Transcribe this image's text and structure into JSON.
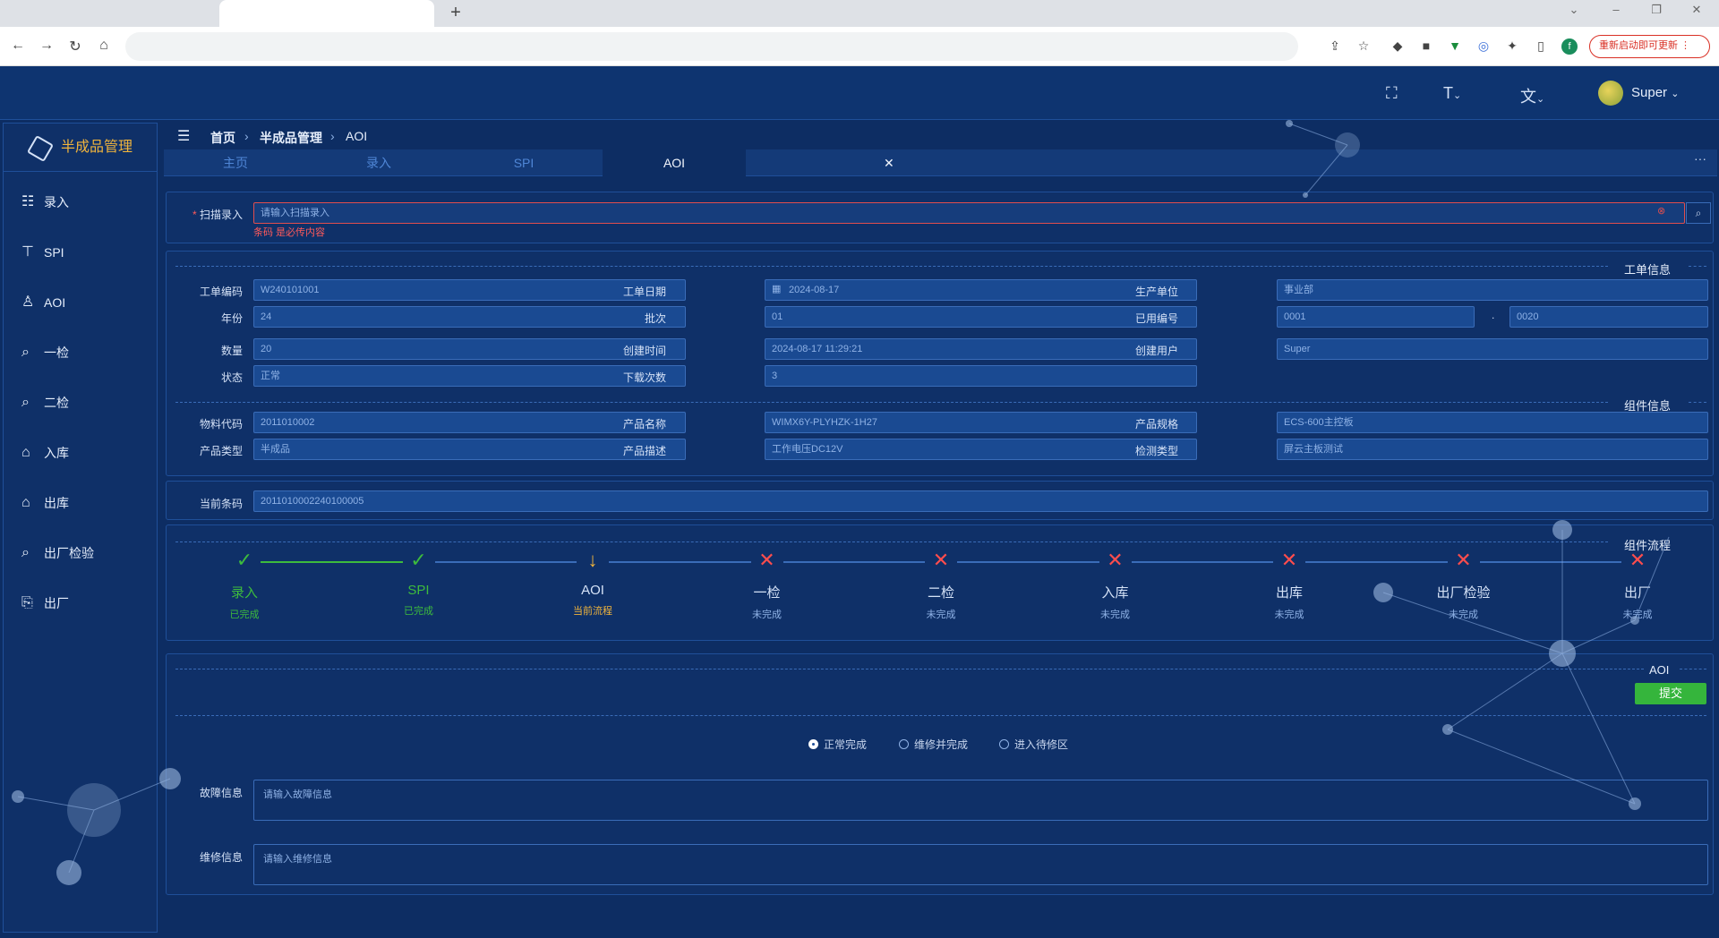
{
  "browser": {
    "update_label": "重新启动即可更新",
    "profile_initial": "f"
  },
  "header": {
    "user_name": "Super"
  },
  "sidebar": {
    "title": "半成品管理",
    "items": [
      {
        "label": "录入",
        "icon": "form-icon"
      },
      {
        "label": "SPI",
        "icon": "paint-roller-icon"
      },
      {
        "label": "AOI",
        "icon": "inspector-icon"
      },
      {
        "label": "一检",
        "icon": "magnifier-icon"
      },
      {
        "label": "二检",
        "icon": "magnifier-icon"
      },
      {
        "label": "入库",
        "icon": "warehouse-icon"
      },
      {
        "label": "出库",
        "icon": "warehouse-icon"
      },
      {
        "label": "出厂检验",
        "icon": "magnifier-icon"
      },
      {
        "label": "出厂",
        "icon": "shipping-icon"
      }
    ]
  },
  "breadcrumb": {
    "home": "首页",
    "parent": "半成品管理",
    "current": "AOI"
  },
  "tabs": [
    {
      "label": "主页"
    },
    {
      "label": "录入"
    },
    {
      "label": "SPI"
    },
    {
      "label": "AOI"
    }
  ],
  "scan": {
    "label": "扫描录入",
    "placeholder": "请输入扫描录入",
    "error": "条码 是必传内容"
  },
  "work_order": {
    "section_title": "工单信息",
    "fields": {
      "code_label": "工单编码",
      "code": "W240101001",
      "date_label": "工单日期",
      "date": "2024-08-17",
      "unit_label": "生产单位",
      "unit": "事业部",
      "year_label": "年份",
      "year": "24",
      "batch_label": "批次",
      "batch": "01",
      "used_no_label": "已用编号",
      "used_no_from": "0001",
      "used_no_to": "0020",
      "qty_label": "数量",
      "qty": "20",
      "created_label": "创建时间",
      "created": "2024-08-17 11:29:21",
      "creator_label": "创建用户",
      "creator": "Super",
      "status_label": "状态",
      "status": "正常",
      "downloads_label": "下载次数",
      "downloads": "3"
    }
  },
  "component": {
    "section_title": "组件信息",
    "fields": {
      "material_label": "物料代码",
      "material": "2011010002",
      "pname_label": "产品名称",
      "pname": "WIMX6Y-PLYHZK-1H27",
      "spec_label": "产品规格",
      "spec": "ECS-600主控板",
      "ptype_label": "产品类型",
      "ptype": "半成品",
      "pdesc_label": "产品描述",
      "pdesc": "工作电压DC12V",
      "inspect_label": "检测类型",
      "inspect": "屏云主板测试"
    }
  },
  "current_barcode": {
    "label": "当前条码",
    "value": "2011010002240100005"
  },
  "flow": {
    "section_title": "组件流程",
    "steps": [
      {
        "name": "录入",
        "status": "已完成",
        "state": "done"
      },
      {
        "name": "SPI",
        "status": "已完成",
        "state": "done"
      },
      {
        "name": "AOI",
        "status": "当前流程",
        "state": "current"
      },
      {
        "name": "一检",
        "status": "未完成",
        "state": "todo"
      },
      {
        "name": "二检",
        "status": "未完成",
        "state": "todo"
      },
      {
        "name": "入库",
        "status": "未完成",
        "state": "todo"
      },
      {
        "name": "出库",
        "status": "未完成",
        "state": "todo"
      },
      {
        "name": "出厂检验",
        "status": "未完成",
        "state": "todo"
      },
      {
        "name": "出厂",
        "status": "未完成",
        "state": "todo"
      }
    ]
  },
  "aoi": {
    "section_title": "AOI",
    "submit_label": "提交",
    "options": [
      {
        "label": "正常完成",
        "selected": true
      },
      {
        "label": "维修并完成",
        "selected": false
      },
      {
        "label": "进入待修区",
        "selected": false
      }
    ],
    "fault_label": "故障信息",
    "fault_placeholder": "请输入故障信息",
    "repair_label": "维修信息",
    "repair_placeholder": "请输入维修信息"
  },
  "colors": {
    "done": "#3dbb3d",
    "current": "#f0b43c",
    "todo": "#ff4d4d"
  }
}
